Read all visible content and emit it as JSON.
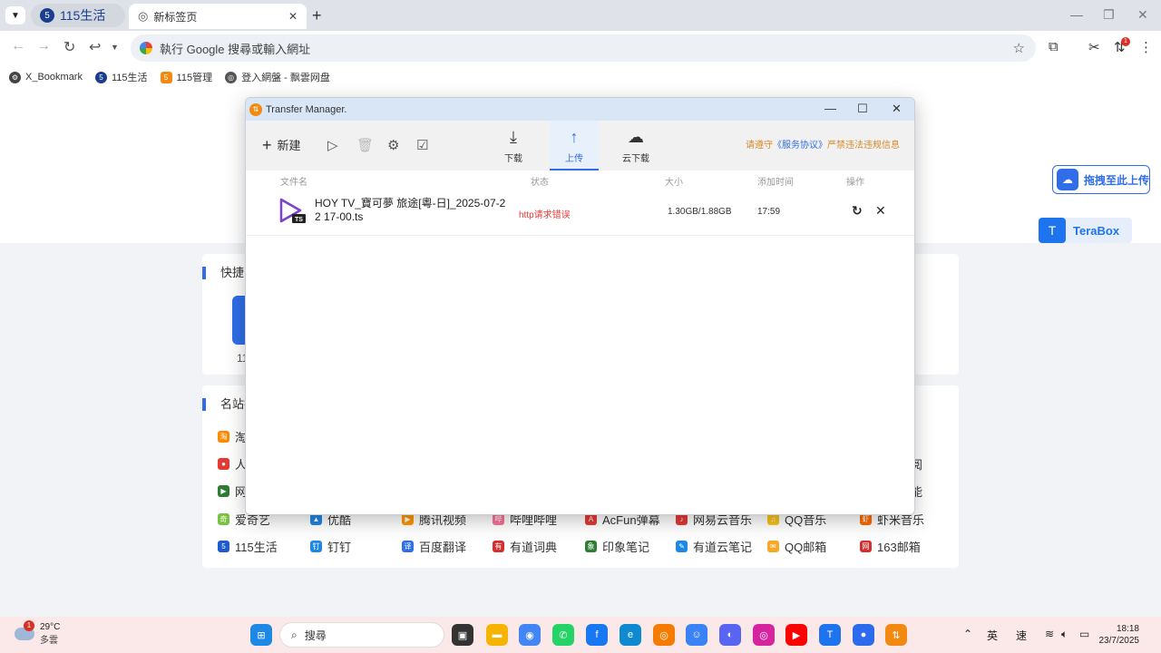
{
  "browser": {
    "tabs": [
      {
        "label": "115生活",
        "icon": "115-logo"
      },
      {
        "label": "新标签页",
        "icon": "blank-tab-icon"
      }
    ],
    "omnibox_placeholder": "執行 Google 搜尋或輸入網址",
    "ext_badge": "1",
    "bookmarks": [
      {
        "label": "X_Bookmark",
        "color": "#444444",
        "icon": "⚙"
      },
      {
        "label": "115生活",
        "color": "#1a3d8f",
        "icon": "5"
      },
      {
        "label": "115管理",
        "color": "#f28a12",
        "icon": "5"
      },
      {
        "label": "登入網盤 - 飘雲网盘",
        "color": "#555555",
        "icon": "◎"
      }
    ]
  },
  "page": {
    "quick_title": "快捷网",
    "quick_tile_label": "11",
    "sites_title": "名站推",
    "left_sites": [
      {
        "label": "淘",
        "color": "#ff8a00",
        "icon": "淘"
      },
      {
        "label": "人",
        "color": "#e53935",
        "icon": "●"
      },
      {
        "label": "网",
        "color": "#2e7d32",
        "icon": "▶"
      }
    ],
    "right_partial": [
      "阅",
      "能"
    ],
    "sites_row1": [
      {
        "label": "爱奇艺",
        "color": "#7cc242",
        "icon": "奇"
      },
      {
        "label": "优酷",
        "color": "#1e88e5",
        "icon": "▲"
      },
      {
        "label": "腾讯视频",
        "color": "#ff9800",
        "icon": "▶"
      },
      {
        "label": "哔哩哔哩",
        "color": "#fb7299",
        "icon": "哔"
      },
      {
        "label": "AcFun弹幕",
        "color": "#e53935",
        "icon": "A"
      },
      {
        "label": "网易云音乐",
        "color": "#e53935",
        "icon": "♪"
      },
      {
        "label": "QQ音乐",
        "color": "#f9c21a",
        "icon": "♫"
      },
      {
        "label": "虾米音乐",
        "color": "#ff6a00",
        "icon": "虾"
      }
    ],
    "sites_row2": [
      {
        "label": "115生活",
        "color": "#1e5bd1",
        "icon": "5"
      },
      {
        "label": "钉钉",
        "color": "#1e88e5",
        "icon": "钉"
      },
      {
        "label": "百度翻译",
        "color": "#2f6ee8",
        "icon": "译"
      },
      {
        "label": "有道词典",
        "color": "#d32f2f",
        "icon": "有"
      },
      {
        "label": "印象笔记",
        "color": "#2e7d32",
        "icon": "象"
      },
      {
        "label": "有道云笔记",
        "color": "#1e88e5",
        "icon": "✎"
      },
      {
        "label": "QQ邮箱",
        "color": "#f9a825",
        "icon": "✉"
      },
      {
        "label": "163邮箱",
        "color": "#d32f2f",
        "icon": "网"
      }
    ],
    "upload_float_label": "拖拽至此上传",
    "terabox_label": "TeraBox"
  },
  "transfer_manager": {
    "title": "Transfer Manager.",
    "new_label": "新建",
    "tabs": [
      {
        "label": "下载",
        "icon": "download-icon",
        "active": false
      },
      {
        "label": "上传",
        "icon": "upload-icon",
        "active": true
      },
      {
        "label": "云下载",
        "icon": "cloud-download-icon",
        "active": false
      }
    ],
    "notice_prefix": "请遵守",
    "notice_link": "《服务协议》",
    "notice_suffix": "严禁违法违规信息",
    "columns": [
      "文件名",
      "状态",
      "大小",
      "添加时间",
      "操作"
    ],
    "files": [
      {
        "name": "HOY TV_寶可夢 旅途[粵-日]_2025-07-22 17-00.ts",
        "status": "http请求错误",
        "size": "1.30GB/1.88GB",
        "time": "17:59",
        "type_badge": "TS"
      }
    ]
  },
  "taskbar": {
    "weather_temp": "29°C",
    "weather_desc": "多雲",
    "weather_badge": "1",
    "search_label": "搜尋",
    "ime1": "英",
    "ime2": "速",
    "time": "18:18",
    "date": "23/7/2025",
    "apps": [
      {
        "name": "start-button",
        "color": "#1e88e5",
        "icon": "⊞"
      },
      {
        "name": "task-view",
        "color": "#333333",
        "icon": "▣"
      },
      {
        "name": "file-explorer",
        "color": "#f6b400",
        "icon": "▬"
      },
      {
        "name": "chrome",
        "color": "#4285f4",
        "icon": "◉"
      },
      {
        "name": "whatsapp",
        "color": "#25d366",
        "icon": "✆"
      },
      {
        "name": "facebook",
        "color": "#1877f2",
        "icon": "f"
      },
      {
        "name": "edge",
        "color": "#0f8ad0",
        "icon": "e"
      },
      {
        "name": "browser-orange",
        "color": "#f57c00",
        "icon": "◎"
      },
      {
        "name": "bot-app",
        "color": "#3b82f6",
        "icon": "☺"
      },
      {
        "name": "discord",
        "color": "#5865f2",
        "icon": "◐"
      },
      {
        "name": "instagram",
        "color": "#d6249f",
        "icon": "◎"
      },
      {
        "name": "youtube",
        "color": "#ff0000",
        "icon": "▶"
      },
      {
        "name": "terabox-app",
        "color": "#1e74ee",
        "icon": "T"
      },
      {
        "name": "signal",
        "color": "#2c6bed",
        "icon": "●"
      },
      {
        "name": "115-app",
        "color": "#f28a12",
        "icon": "⇅"
      }
    ]
  }
}
